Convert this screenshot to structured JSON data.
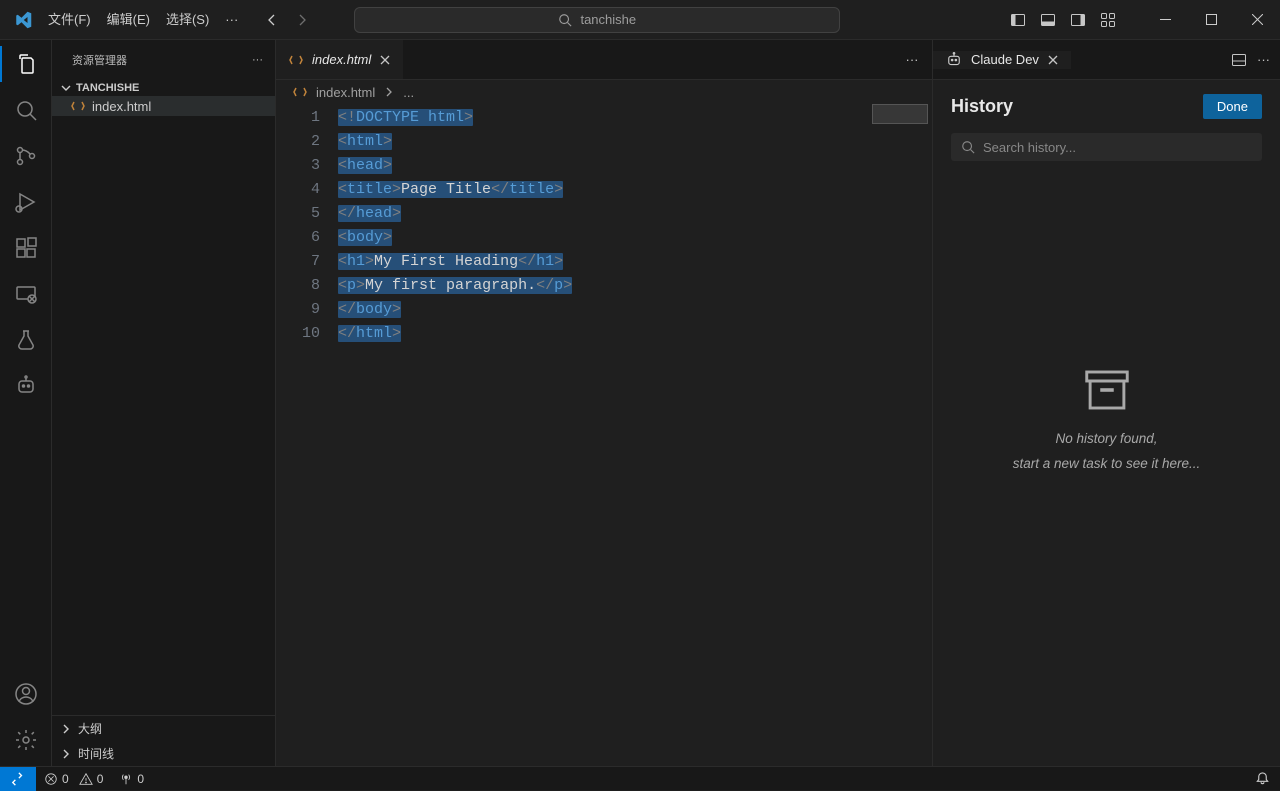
{
  "titlebar": {
    "menus": [
      "文件(F)",
      "编辑(E)",
      "选择(S)",
      "···"
    ],
    "search_text": "tanchishe"
  },
  "sidebar": {
    "header": "资源管理器",
    "folder": "TANCHISHE",
    "file": "index.html",
    "outline": "大纲",
    "timeline": "时间线"
  },
  "editor": {
    "tab_name": "index.html",
    "breadcrumb_file": "index.html",
    "breadcrumb_more": "...",
    "lines": {
      "l1a": "<!",
      "l1b": "DOCTYPE",
      "l1c": " html",
      "l1d": ">",
      "l2a": "<",
      "l2b": "html",
      "l2c": ">",
      "l3a": "<",
      "l3b": "head",
      "l3c": ">",
      "l4a": "<",
      "l4b": "title",
      "l4c": ">",
      "l4d": "Page Title",
      "l4e": "</",
      "l4f": "title",
      "l4g": ">",
      "l5a": "</",
      "l5b": "head",
      "l5c": ">",
      "l6a": "<",
      "l6b": "body",
      "l6c": ">",
      "l7a": "<",
      "l7b": "h1",
      "l7c": ">",
      "l7d": "My First Heading",
      "l7e": "</",
      "l7f": "h1",
      "l7g": ">",
      "l8a": "<",
      "l8b": "p",
      "l8c": ">",
      "l8d": "My first paragraph.",
      "l8e": "</",
      "l8f": "p",
      "l8g": ">",
      "l9a": "</",
      "l9b": "body",
      "l9c": ">",
      "l10a": "</",
      "l10b": "html",
      "l10c": ">"
    },
    "numbers": [
      "1",
      "2",
      "3",
      "4",
      "5",
      "6",
      "7",
      "8",
      "9",
      "10"
    ]
  },
  "claude": {
    "tab_name": "Claude Dev",
    "title": "History",
    "done": "Done",
    "search_placeholder": "Search history...",
    "empty_line1": "No history found,",
    "empty_line2": "start a new task to see it here..."
  },
  "status": {
    "errors": "0",
    "warnings": "0",
    "ports": "0"
  }
}
